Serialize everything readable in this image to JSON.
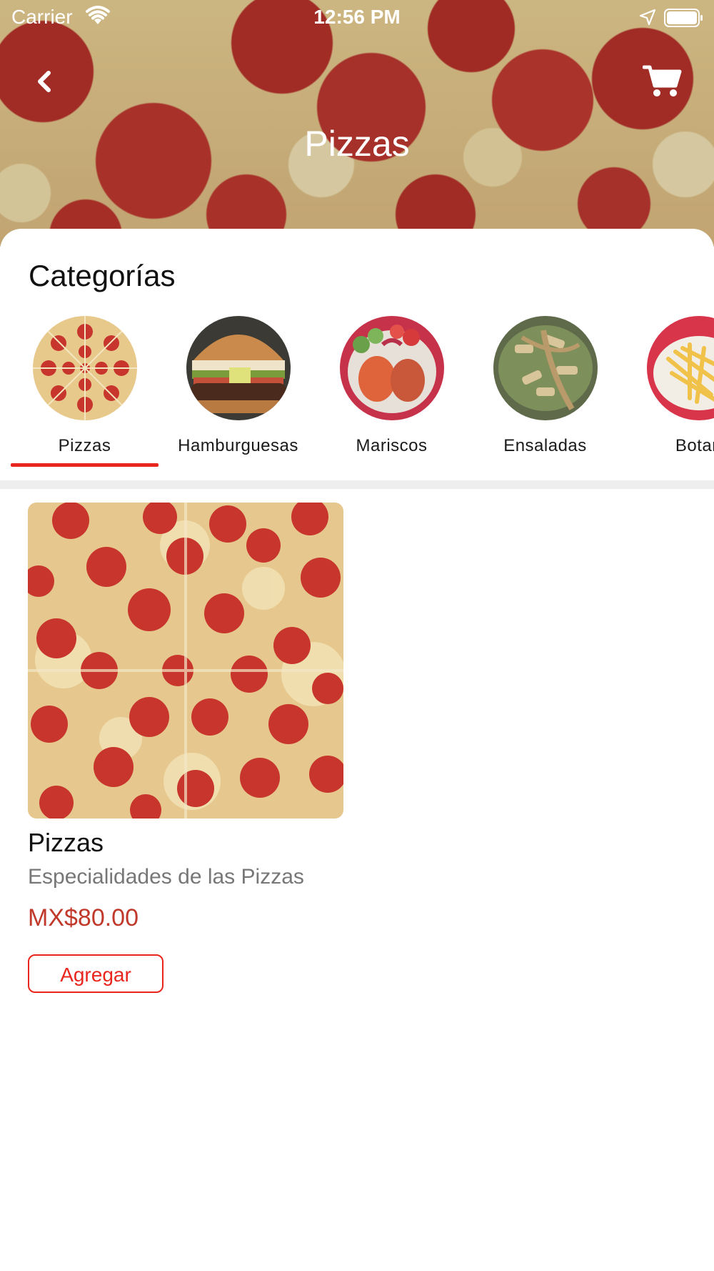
{
  "status_bar": {
    "carrier": "Carrier",
    "time": "12:56 PM"
  },
  "header": {
    "title": "Pizzas",
    "back_icon": "chevron-left-icon",
    "cart_icon": "cart-icon"
  },
  "categories": {
    "heading": "Categorías",
    "selected": "Pizzas",
    "items": [
      {
        "label": "Pizzas"
      },
      {
        "label": "Hamburguesas"
      },
      {
        "label": "Mariscos"
      },
      {
        "label": "Ensaladas"
      },
      {
        "label": "Botan"
      }
    ]
  },
  "products": [
    {
      "name": "Pizzas",
      "description": "Especialidades de las Pizzas",
      "price": "MX$80.00",
      "button_label": "Agregar"
    }
  ],
  "colors": {
    "accent": "#e8261e",
    "price": "#c0392b",
    "text_secondary": "#777777"
  }
}
